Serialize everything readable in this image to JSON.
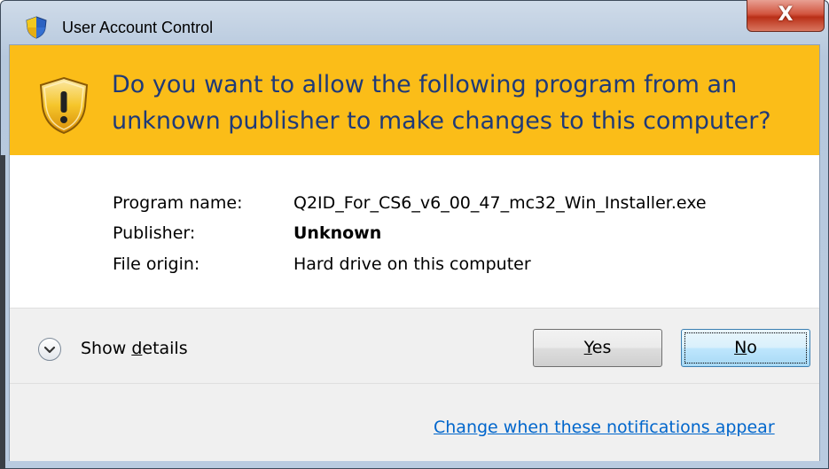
{
  "window": {
    "title": "User Account Control",
    "close_glyph": "X"
  },
  "banner": {
    "question": "Do you want to allow the following program from an unknown publisher to make changes to this computer?",
    "background": "#fbbd18",
    "text_color": "#1f3a78",
    "icon": "warning-shield-icon"
  },
  "details": {
    "program_name_label": "Program name:",
    "program_name_value": "Q2ID_For_CS6_v6_00_47_mc32_Win_Installer.exe",
    "publisher_label": "Publisher:",
    "publisher_value": "Unknown",
    "file_origin_label": "File origin:",
    "file_origin_value": "Hard drive on this computer"
  },
  "footer": {
    "show_details_prefix": "Show ",
    "show_details_mnemonic": "d",
    "show_details_suffix": "etails",
    "yes_mnemonic": "Y",
    "yes_suffix": "es",
    "no_mnemonic": "N",
    "no_suffix": "o",
    "notifications_link": "Change when these notifications appear",
    "link_color": "#0066cc"
  }
}
